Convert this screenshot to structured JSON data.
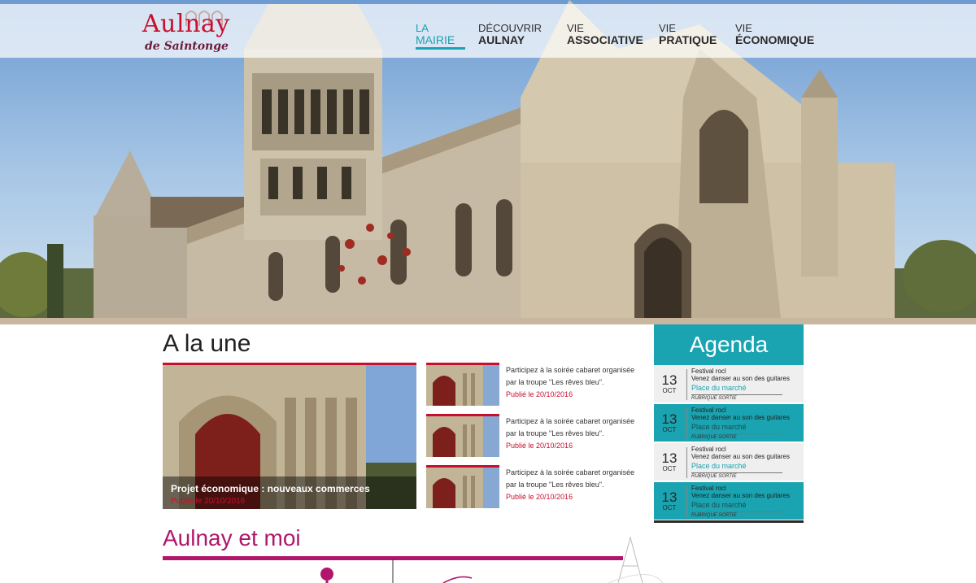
{
  "brand": {
    "name": "Aulnay",
    "subtitle": "de Saintonge"
  },
  "nav": [
    {
      "line1": "LA",
      "line2": "MAIRIE",
      "active": true
    },
    {
      "line1": "DÉCOUVRIR",
      "line2": "AULNAY",
      "active": false
    },
    {
      "line1": "VIE",
      "line2": "ASSOCIATIVE",
      "active": false
    },
    {
      "line1": "VIE",
      "line2": "PRATIQUE",
      "active": false
    },
    {
      "line1": "VIE",
      "line2": "ÉCONOMIQUE",
      "active": false
    }
  ],
  "alaune": {
    "title": "A la une",
    "featured": {
      "title": "Projet économique :  nouveaux commerces",
      "date": "Publié le 20/10/2016"
    },
    "news": [
      {
        "line1": "Participez à la soirée cabaret organisée",
        "line2": "par la troupe \"Les rêves bleu\".",
        "date": "Publié le 20/10/2016"
      },
      {
        "line1": "Participez à la soirée cabaret organisée",
        "line2": "par la troupe \"Les rêves bleu\".",
        "date": "Publié le 20/10/2016"
      },
      {
        "line1": "Participez à la soirée cabaret organisée",
        "line2": "par la troupe \"Les rêves bleu\".",
        "date": "Publié le 20/10/2016"
      }
    ]
  },
  "agenda": {
    "title": "Agenda",
    "events": [
      {
        "day": "13",
        "month": "OCT",
        "title": "Festival rocl",
        "desc": "Venez danser au son des guitares",
        "place": "Place du marché",
        "rubric": "RUBRIQUE SORTIE"
      },
      {
        "day": "13",
        "month": "OCT",
        "title": "Festival rocl",
        "desc": "Venez danser au son des guitares",
        "place": "Place du marché",
        "rubric": "RUBRIQUE SORTIE"
      },
      {
        "day": "13",
        "month": "OCT",
        "title": "Festival rocl",
        "desc": "Venez danser au son des guitares",
        "place": "Place du marché",
        "rubric": "RUBRIQUE SORTIE"
      },
      {
        "day": "13",
        "month": "OCT",
        "title": "Festival rocl",
        "desc": "Venez danser au son des guitares",
        "place": "Place du marché",
        "rubric": "RUBRIQUE SORTIE"
      }
    ]
  },
  "aulnay_moi": {
    "title": "Aulnay et moi"
  },
  "colors": {
    "teal": "#1aa3b0",
    "red": "#c8102e",
    "magenta": "#b0166b"
  }
}
